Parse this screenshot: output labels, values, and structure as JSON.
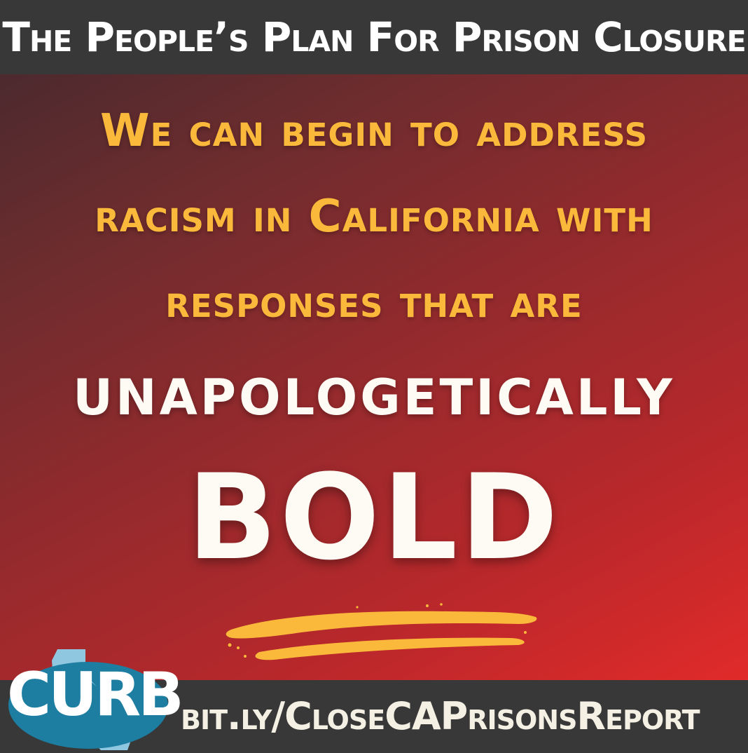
{
  "header": {
    "title": "The People’s Plan For Prison Closure"
  },
  "message": {
    "line1": "We can begin to address",
    "line2": "racism in California with",
    "line3": "responses that are",
    "line4": "UNAPOLOGETICALLY",
    "emphasis": "BOLD"
  },
  "footer": {
    "logo_text": "CURB",
    "url": "bit.ly/CloseCAPrisonsReport"
  },
  "colors": {
    "bar_background": "#383838",
    "headline_gold": "#fbb93c",
    "cream_text": "#fdfbf4",
    "logo_blue": "#1d7ea2",
    "logo_light_blue": "#8fc6e0",
    "gradient_dark": "#4c2a2e",
    "gradient_red": "#e12a2a"
  },
  "icons": {
    "logo_shape": "california-state-icon",
    "underline": "brush-stroke-underline-icon"
  }
}
